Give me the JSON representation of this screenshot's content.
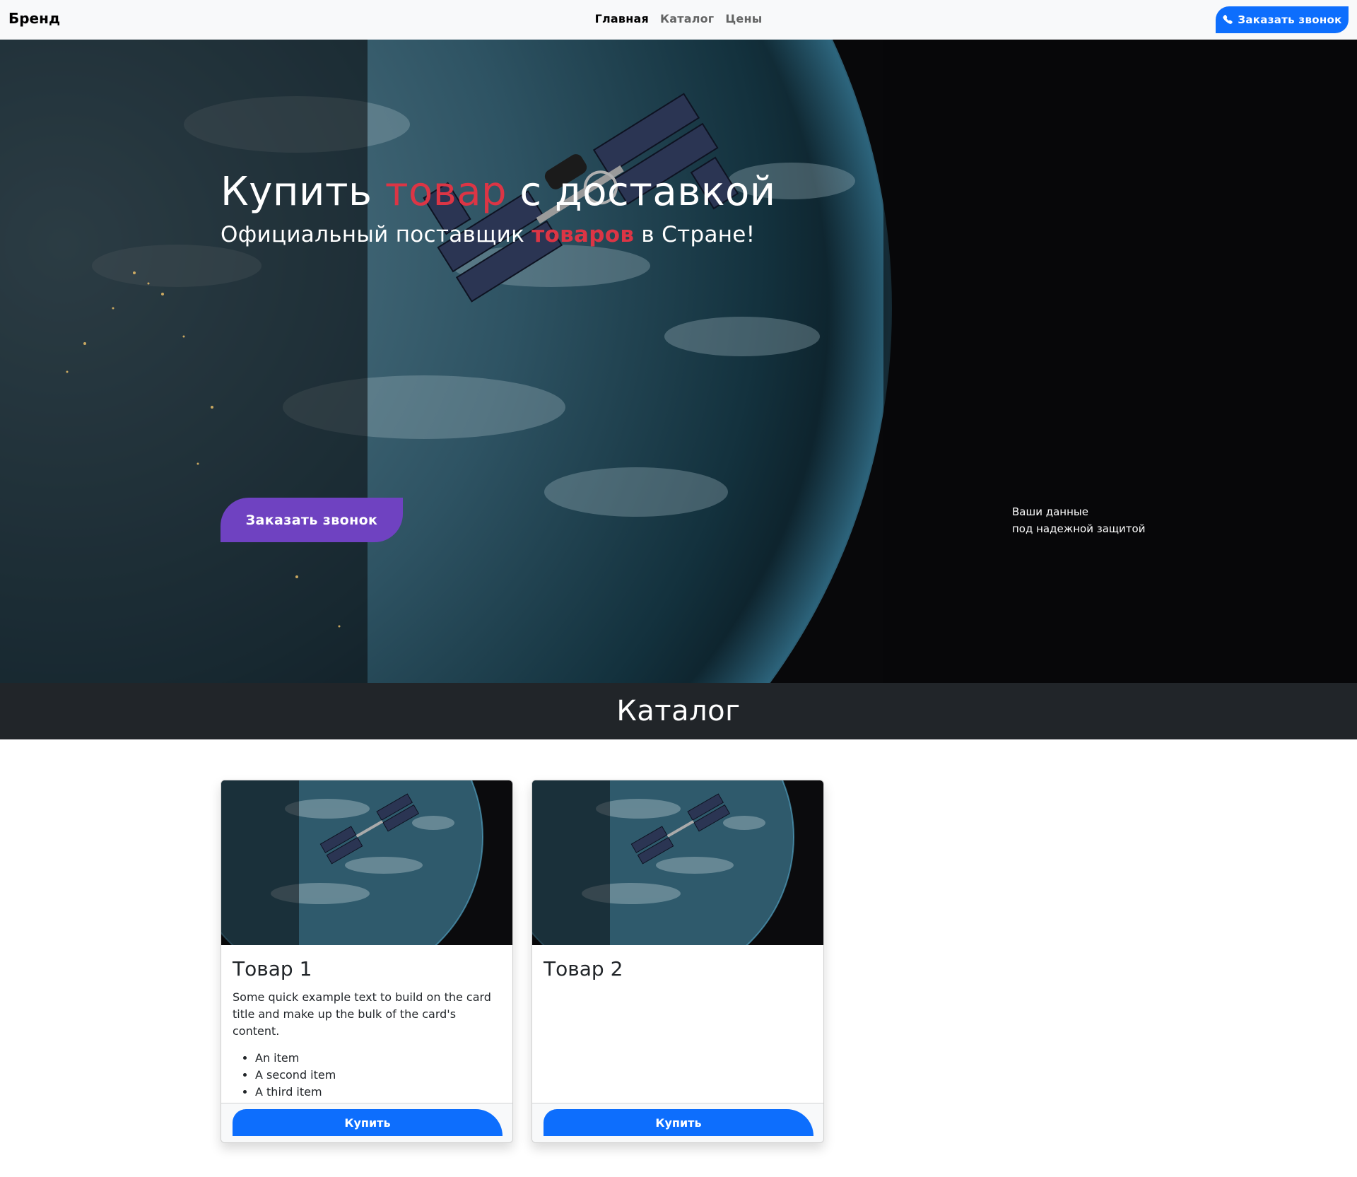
{
  "navbar": {
    "brand": "Бренд",
    "links": [
      {
        "label": "Главная",
        "active": true
      },
      {
        "label": "Каталог",
        "active": false
      },
      {
        "label": "Цены",
        "active": false
      }
    ],
    "call_button": "Заказать звонок",
    "call_icon": "phone-icon"
  },
  "hero": {
    "title_part1": "Купить ",
    "title_accent": "товар",
    "title_part2": " с доставкой",
    "subtitle_part1": "Официальный поставщик ",
    "subtitle_accent": "товаров",
    "subtitle_part2": " в Стране!",
    "call_button": "Заказать звонок",
    "secure_line1": "Ваши данные",
    "secure_line2": "под надежной защитой"
  },
  "catalog": {
    "heading": "Каталог",
    "cards": [
      {
        "title": "Товар 1",
        "text": "Some quick example text to build on the card title and make up the bulk of the card's content.",
        "items": [
          "An item",
          "A second item",
          "A third item"
        ],
        "button": "Купить"
      },
      {
        "title": "Товар 2",
        "button": "Купить"
      }
    ]
  },
  "colors": {
    "accent_red": "#dc3545",
    "primary_blue": "#0d6efd",
    "purple": "#6f42c1",
    "dark_band": "#212529"
  }
}
